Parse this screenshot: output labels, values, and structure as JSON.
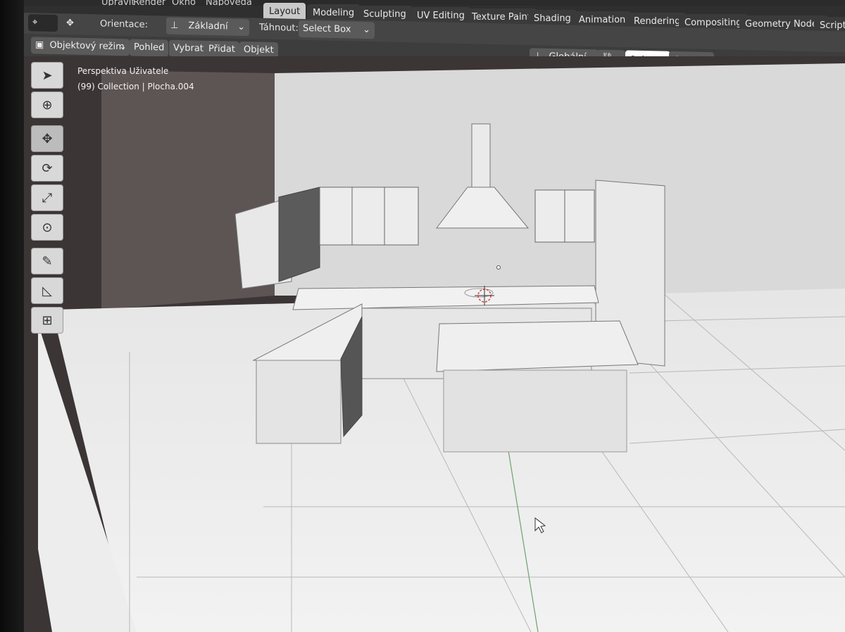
{
  "menubar": [
    "Upravit",
    "Render",
    "Okno",
    "Nápověda"
  ],
  "tabs": [
    "Layout",
    "Modeling",
    "Sculpting",
    "UV Editing",
    "Texture Paint",
    "Shading",
    "Animation",
    "Rendering",
    "Compositing",
    "Geometry Nodes",
    "Scriptin"
  ],
  "toolbar": {
    "orientation_label": "Orientace:",
    "orientation_value": "Základní",
    "drag_label": "Táhnout:",
    "drag_value": "Select Box"
  },
  "header": {
    "mode": "Objektový režim",
    "menu": [
      "Pohled",
      "Vybrat",
      "Přidat",
      "Objekt"
    ],
    "transform": "Globální"
  },
  "viewport": {
    "view_name": "Perspektiva Uživatele",
    "collection": "(99) Collection | Plocha.004"
  },
  "tools": [
    "select-icon",
    "cursor-icon",
    "move-icon",
    "rotate-icon",
    "scale-icon",
    "transform-icon",
    "annotate-icon",
    "measure-icon",
    "add-cube-icon"
  ]
}
